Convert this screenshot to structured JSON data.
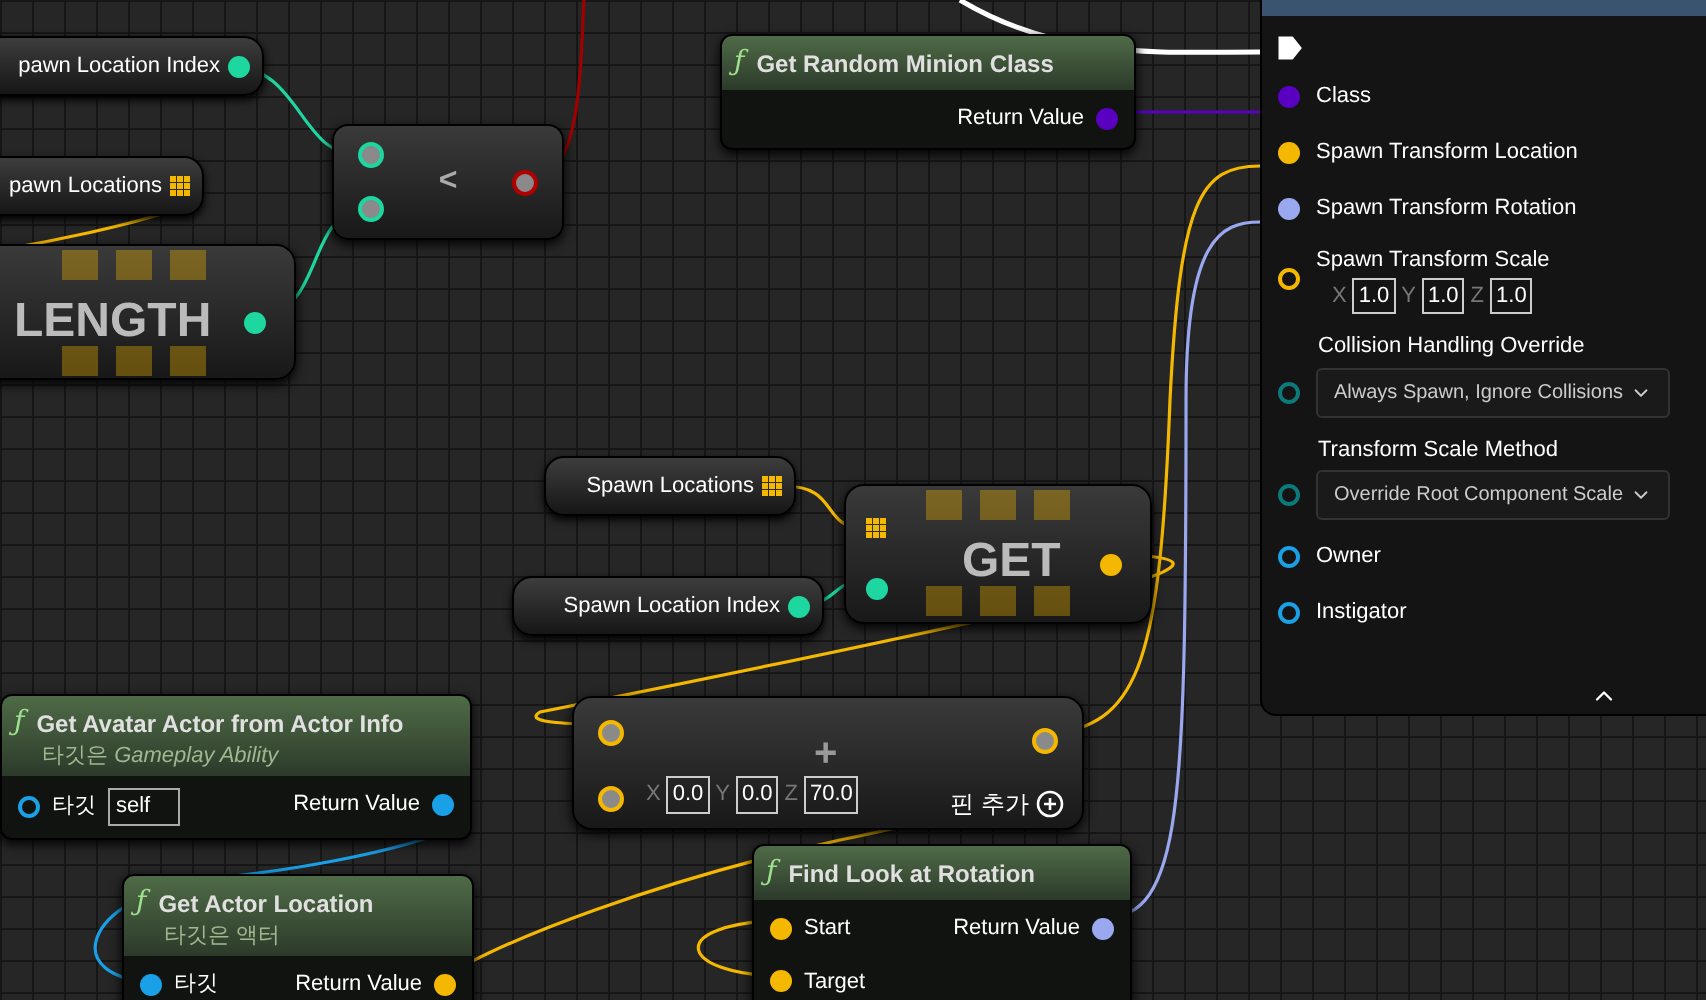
{
  "variables": [
    {
      "label": "pawn Location Index",
      "kind": "single",
      "color": "#1ed6a0"
    },
    {
      "label": "pawn Locations",
      "kind": "array",
      "color": "#f5b800"
    },
    {
      "label": "Spawn Locations",
      "kind": "array",
      "color": "#f5b800"
    },
    {
      "label": "Spawn Location Index",
      "kind": "single",
      "color": "#1ed6a0"
    }
  ],
  "length_node": {
    "title": "LENGTH",
    "pins": [
      {
        "color": "#1ed6a0"
      }
    ]
  },
  "compare_node": {
    "operator": "<",
    "pins": [
      {
        "color": "#1ed6a0"
      },
      {
        "color": "#1ed6a0"
      },
      {
        "color": "#b00000"
      }
    ]
  },
  "get_node": {
    "title": "GET",
    "pins": [
      {
        "color": "#f5b800"
      },
      {
        "color": "#1ed6a0"
      },
      {
        "color": "#f5b800"
      }
    ]
  },
  "add_node": {
    "operator": "+",
    "color": "#f5b800",
    "fields": [
      {
        "axis": "X",
        "value": "0.0"
      },
      {
        "axis": "Y",
        "value": "0.0"
      },
      {
        "axis": "Z",
        "value": "70.0"
      }
    ],
    "add_pin": "핀 추가"
  },
  "functions": [
    {
      "icon": "ƒ",
      "title": "Get Random Minion Class",
      "outputs": [
        {
          "label": "Return Value",
          "color": "#5a00c0",
          "connected": true
        }
      ]
    },
    {
      "icon": "ƒ",
      "title": "Get Avatar Actor from Actor Info",
      "subtitle": "타깃은 *Gameplay Ability*",
      "inputs": [
        {
          "label": "타깃",
          "color": "#1aa0e6",
          "connected": false,
          "value": "self"
        }
      ],
      "outputs": [
        {
          "label": "Return Value",
          "color": "#1aa0e6",
          "connected": true
        }
      ]
    },
    {
      "icon": "ƒ",
      "title": "Get Actor Location",
      "subtitle": "타깃은 액터",
      "inputs": [
        {
          "label": "타깃",
          "color": "#1aa0e6",
          "connected": true
        }
      ],
      "outputs": [
        {
          "label": "Return Value",
          "color": "#f5b800",
          "connected": true
        }
      ]
    },
    {
      "icon": "ƒ",
      "title": "Find Look at Rotation",
      "inputs": [
        {
          "label": "Start",
          "color": "#f5b800",
          "connected": true
        },
        {
          "label": "Target",
          "color": "#f5b800",
          "connected": true
        }
      ],
      "outputs": [
        {
          "label": "Return Value",
          "color": "#9aa8f0",
          "connected": true
        }
      ]
    }
  ],
  "spawn_panel": {
    "pins": [
      {
        "kind": "exec",
        "color": "#ffffff",
        "connected": true
      },
      {
        "kind": "pin",
        "label": "Class",
        "color": "#5a00c0",
        "connected": true
      },
      {
        "kind": "pin",
        "label": "Spawn Transform Location",
        "color": "#f5b800",
        "connected": true
      },
      {
        "kind": "pin",
        "label": "Spawn Transform Rotation",
        "color": "#9aa8f0",
        "connected": true
      },
      {
        "kind": "vector",
        "label": "Spawn Transform Scale",
        "color": "#f5b800",
        "connected": false,
        "fields": [
          {
            "axis": "X",
            "value": "1.0"
          },
          {
            "axis": "Y",
            "value": "1.0"
          },
          {
            "axis": "Z",
            "value": "1.0"
          }
        ]
      },
      {
        "kind": "dropdown",
        "label": "Collision Handling Override",
        "color": "#0b7a7a",
        "connected": false,
        "value": "Always Spawn, Ignore Collisions"
      },
      {
        "kind": "dropdown",
        "label": "Transform Scale Method",
        "color": "#0b7a7a",
        "connected": false,
        "value": "Override Root Component Scale"
      },
      {
        "kind": "pin",
        "label": "Owner",
        "color": "#1aa0e6",
        "connected": false
      },
      {
        "kind": "pin",
        "label": "Instigator",
        "color": "#1aa0e6",
        "connected": false
      }
    ]
  }
}
